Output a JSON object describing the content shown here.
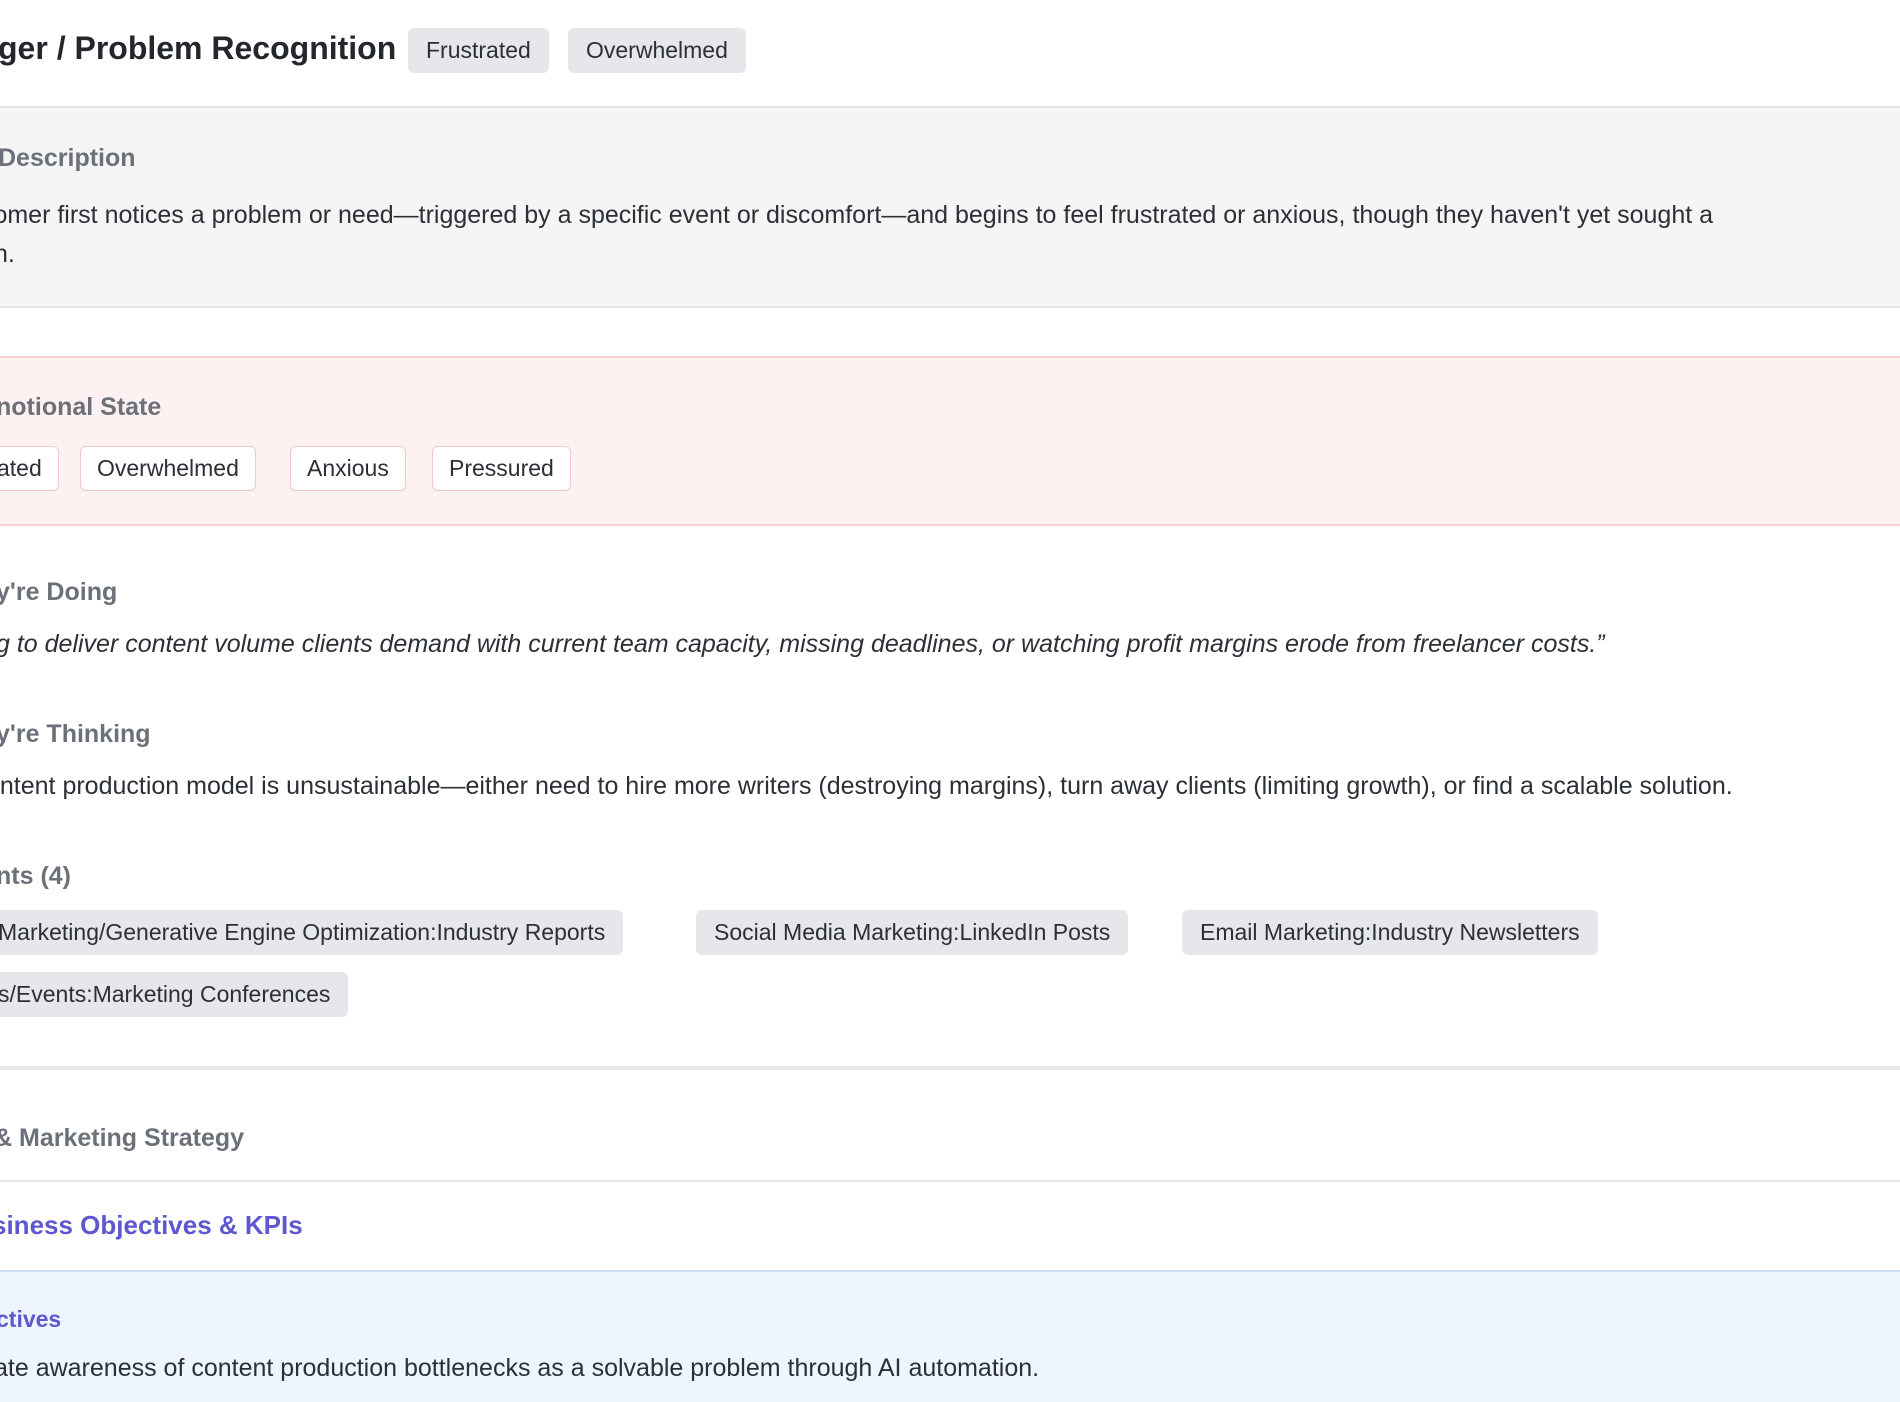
{
  "header": {
    "title": "ger / Problem Recognition",
    "emotion_chips": [
      "Frustrated",
      "Overwhelmed"
    ]
  },
  "description": {
    "label": "Description",
    "text": "stomer first notices a problem or need—triggered by a specific event or discomfort—and begins to feel frustrated or anxious, though they haven't yet sought a",
    "text_line2": "n."
  },
  "emotional_state": {
    "label": "notional State",
    "chips": [
      "ated",
      "Overwhelmed",
      "Anxious",
      "Pressured"
    ]
  },
  "doing": {
    "label": "y're Doing",
    "text": "g to deliver content volume clients demand with current team capacity, missing deadlines, or watching profit margins erode from freelancer costs.”"
  },
  "thinking": {
    "label": "y're Thinking",
    "text": "ontent production model is unsustainable—either need to hire more writers (destroying margins), turn away clients (limiting growth), or find a scalable solution."
  },
  "touchpoints": {
    "label": "nts (4)",
    "chips": [
      "Marketing/Generative Engine Optimization:Industry Reports",
      "Social Media Marketing:LinkedIn Posts",
      "Email Marketing:Industry Newsletters",
      "s/Events:Marketing Conferences"
    ]
  },
  "strategy": {
    "label": "& Marketing Strategy",
    "link": "siness Objectives & KPIs"
  },
  "objectives": {
    "label": "ctives",
    "text": "ate awareness of content production bottlenecks as a solvable problem through AI automation."
  }
}
